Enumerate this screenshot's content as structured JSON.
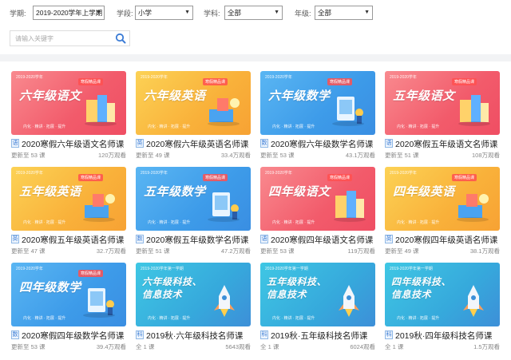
{
  "filters": [
    {
      "label": "学期:",
      "value": "2019-2020学年上学期"
    },
    {
      "label": "学段:",
      "value": "小学"
    },
    {
      "label": "学科:",
      "value": "全部"
    },
    {
      "label": "年级:",
      "value": "全部"
    }
  ],
  "search": {
    "placeholder": "请输入关键字"
  },
  "thumb_common": {
    "slogan": "内化 · 精讲 · 拓展 · 提升",
    "tag": "寒假精品课"
  },
  "courses": [
    {
      "thumb_title": "六年级语文",
      "thumb_top": "2019-2020学年",
      "theme": "red",
      "badge": "语",
      "title": "2020寒假六年级语文名师课",
      "updated": "更新至 53 课",
      "views": "120万观看"
    },
    {
      "thumb_title": "六年级英语",
      "thumb_top": "2019-2020学年",
      "theme": "orange",
      "badge": "英",
      "title": "2020寒假六年级英语名师课",
      "updated": "更新至 49 课",
      "views": "33.4万观看"
    },
    {
      "thumb_title": "六年级数学",
      "thumb_top": "2019-2020学年",
      "theme": "blue",
      "badge": "数",
      "title": "2020寒假六年级数学名师课",
      "updated": "更新至 53 课",
      "views": "43.1万观看"
    },
    {
      "thumb_title": "五年级语文",
      "thumb_top": "2019-2020学年",
      "theme": "red",
      "badge": "语",
      "title": "2020寒假五年级语文名师课",
      "updated": "更新至 51 课",
      "views": "108万观看"
    },
    {
      "thumb_title": "五年级英语",
      "thumb_top": "2019-2020学年",
      "theme": "orange",
      "badge": "英",
      "title": "2020寒假五年级英语名师课",
      "updated": "更新至 47 课",
      "views": "32.7万观看"
    },
    {
      "thumb_title": "五年级数学",
      "thumb_top": "2019-2020学年",
      "theme": "blue",
      "badge": "数",
      "title": "2020寒假五年级数学名师课",
      "updated": "更新至 51 课",
      "views": "47.2万观看"
    },
    {
      "thumb_title": "四年级语文",
      "thumb_top": "2019-2020学年",
      "theme": "red",
      "badge": "语",
      "title": "2020寒假四年级语文名师课",
      "updated": "更新至 53 课",
      "views": "119万观看"
    },
    {
      "thumb_title": "四年级英语",
      "thumb_top": "2019-2020学年",
      "theme": "orange",
      "badge": "英",
      "title": "2020寒假四年级英语名师课",
      "updated": "更新至 49 课",
      "views": "38.1万观看"
    },
    {
      "thumb_title": "四年级数学",
      "thumb_top": "2019-2020学年",
      "theme": "blue",
      "badge": "数",
      "title": "2020寒假四年级数学名师课",
      "updated": "更新至 53 课",
      "views": "39.4万观看"
    },
    {
      "thumb_title": "六年级科技、信息技术",
      "thumb_top": "2019-2020学年第一学期",
      "theme": "teal",
      "badge": "科",
      "title": "2019秋·六年级科技名师课",
      "updated": "全 1 课",
      "views": "5643观看"
    },
    {
      "thumb_title": "五年级科技、信息技术",
      "thumb_top": "2019-2020学年第一学期",
      "theme": "teal",
      "badge": "科",
      "title": "2019秋·五年级科技名师课",
      "updated": "全 1 课",
      "views": "6024观看"
    },
    {
      "thumb_title": "四年级科技、信息技术",
      "thumb_top": "2019-2020学年第一学期",
      "theme": "teal",
      "badge": "科",
      "title": "2019秋·四年级科技名师课",
      "updated": "全 1 课",
      "views": "1.5万观看"
    }
  ],
  "colors": {
    "red": "#f45c6a",
    "orange": "#f9b233",
    "blue": "#3d9be9",
    "teal": "#36b6d9",
    "accent": "#3a7bd5"
  }
}
